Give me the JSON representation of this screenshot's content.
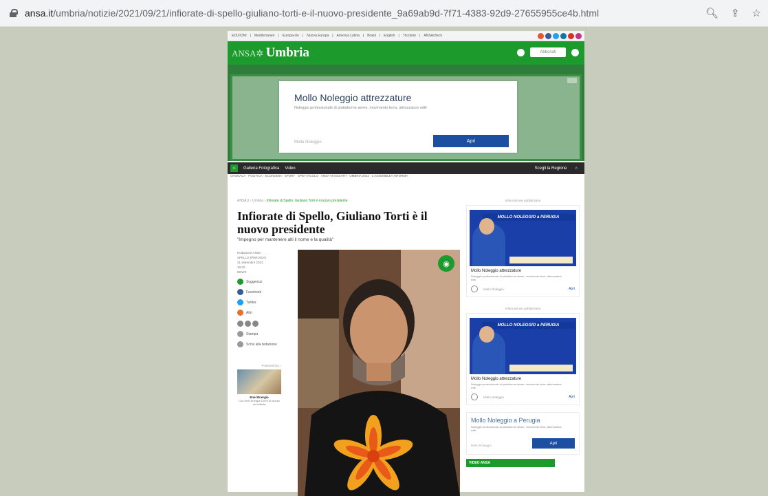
{
  "browser": {
    "url_domain": "ansa.it",
    "url_path": "/umbria/notizie/2021/09/21/infiorate-di-spello-giuliano-torti-e-il-nuovo-presidente_9a69ab9d-7f71-4383-92d9-27655955ce4b.html"
  },
  "site": {
    "logo_prefix": "ANSA",
    "logo_region": "Umbria",
    "header_button": "Abbonati"
  },
  "top_ad": {
    "title": "Mollo Noleggio attrezzature",
    "description": "Noleggio professionale di piattaforme aeree, movimento terra, attrezzature edili",
    "source": "Mollo Noleggio",
    "button": "Apri"
  },
  "subnav": {
    "items": [
      "Galleria Fotografica",
      "Video"
    ],
    "right": "Scegli la Regione"
  },
  "article": {
    "breadcrumb": [
      "ANSA.it",
      "Umbria"
    ],
    "breadcrumb_current": "Infiorate di Spello, Giuliano Torti è il nuovo presidente",
    "title": "Infiorate di Spello, Giuliano Torti è il nuovo presidente",
    "subtitle": "\"Impegno per mantenere alti il nome e la qualità\"",
    "author": "Redazione ANSA",
    "share": [
      "Suggerisci",
      "Facebook",
      "Twitter",
      "Altri"
    ],
    "promo_caption": "Enel Energia"
  },
  "sidebar_ad": {
    "label": "Informazione pubblicitaria",
    "banner": "MOLLO NOLEGGIO a PERUGIA",
    "title": "Mollo Noleggio attrezzature",
    "description": "Noleggio professionale di piattaforme aeree, movimento terra, attrezzature edili",
    "source": "Mollo Noleggio",
    "link": "Apri"
  },
  "small_ad": {
    "title": "Mollo Noleggio a Perugia",
    "source": "Mollo Noleggio",
    "button": "Apri"
  },
  "video_section": "VIDEO ANSA",
  "colors": {
    "brand_green": "#1c9a2c",
    "ad_blue": "#1d4fa0"
  }
}
